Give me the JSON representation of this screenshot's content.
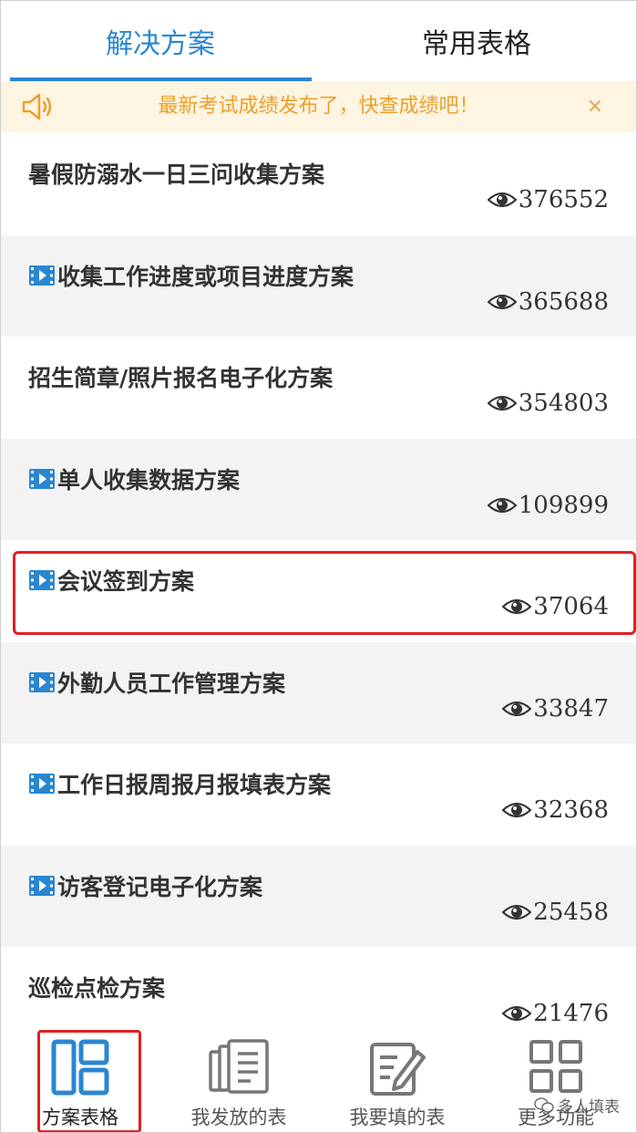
{
  "tabs": [
    {
      "label": "解决方案",
      "active": true
    },
    {
      "label": "常用表格",
      "active": false
    }
  ],
  "notice": {
    "text": "最新考试成绩发布了，快查成绩吧！",
    "close": "×",
    "icon": "speaker-icon"
  },
  "list": [
    {
      "title": "暑假防溺水一日三问收集方案",
      "views": "376552",
      "video": false
    },
    {
      "title": "收集工作进度或项目进度方案",
      "views": "365688",
      "video": true
    },
    {
      "title": "招生简章/照片报名电子化方案",
      "views": "354803",
      "video": false
    },
    {
      "title": "单人收集数据方案",
      "views": "109899",
      "video": true
    },
    {
      "title": "会议签到方案",
      "views": "37064",
      "video": true
    },
    {
      "title": "外勤人员工作管理方案",
      "views": "33847",
      "video": true
    },
    {
      "title": "工作日报周报月报填表方案",
      "views": "32368",
      "video": true
    },
    {
      "title": "访客登记电子化方案",
      "views": "25458",
      "video": true
    },
    {
      "title": "巡检点检方案",
      "views": "21476",
      "video": false
    }
  ],
  "bottom_nav": [
    {
      "label": "方案表格",
      "icon": "layout-grid-icon",
      "active": true
    },
    {
      "label": "我发放的表",
      "icon": "documents-icon",
      "active": false
    },
    {
      "label": "我要填的表",
      "icon": "edit-form-icon",
      "active": false
    },
    {
      "label": "更多功能",
      "icon": "apps-grid-icon",
      "active": false
    }
  ],
  "watermark": {
    "text": "多人填表"
  },
  "colors": {
    "accent": "#2a86d1",
    "notice_bg": "#fdf4e1",
    "notice_text": "#ee9f2b",
    "highlight": "#e02020"
  }
}
